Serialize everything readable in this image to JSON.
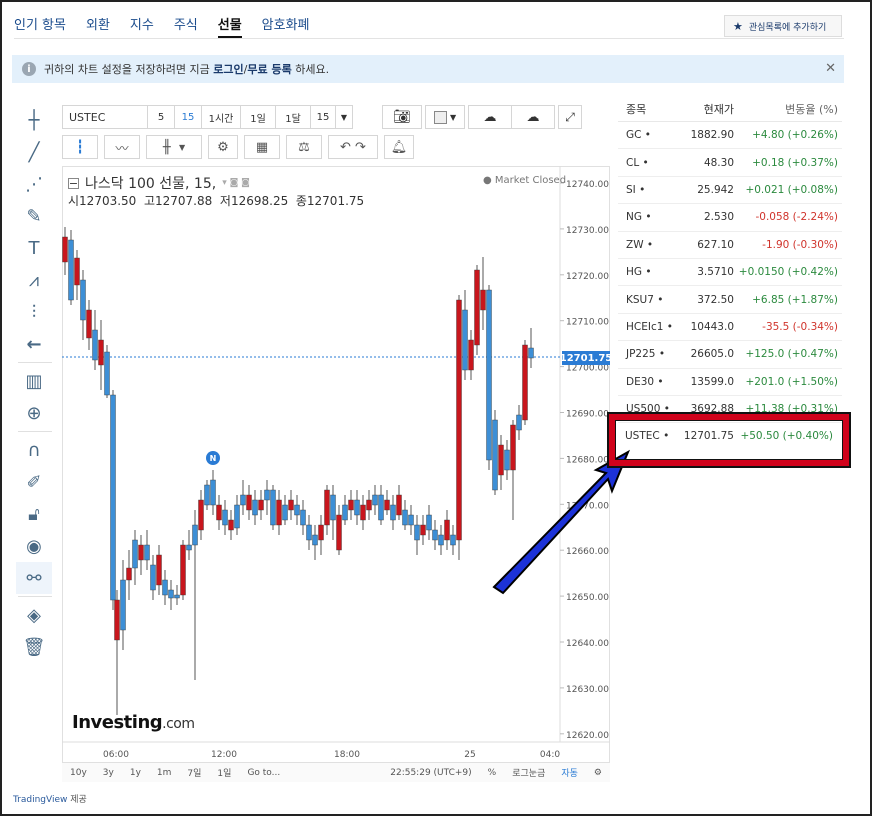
{
  "nav": {
    "tabs": [
      "인기 항목",
      "외환",
      "지수",
      "주식",
      "선물",
      "암호화폐"
    ],
    "active": 4,
    "watch_label": "관심목록에 추가하기"
  },
  "banner": {
    "prefix": "귀하의 차트 설정을 저장하려면 지금",
    "login": "로그인",
    "sep": " / ",
    "register": "무료 등록",
    "suffix": "하세요."
  },
  "toolbar": {
    "symbol": "USTEC",
    "intervals": [
      "5",
      "15",
      "1시간",
      "1일",
      "1달",
      "15"
    ],
    "active_interval": "15"
  },
  "chart": {
    "title": "나스닥 100 선물, 15,",
    "o_label": "시",
    "o": "12703.50",
    "h_label": "고",
    "h": "12707.88",
    "l_label": "저",
    "l": "12698.25",
    "c_label": "종",
    "c": "12701.75",
    "market_status": "Market Closed",
    "price_tag": "12701.75",
    "logo_main": "Investing",
    "logo_dot": ".com",
    "event_badge": "N",
    "y_ticks": [
      "12740.00",
      "12730.00",
      "12720.00",
      "12710.00",
      "12700.00",
      "12690.00",
      "12680.00",
      "12670.00",
      "12660.00",
      "12650.00",
      "12640.00",
      "12630.00",
      "12620.00"
    ],
    "x_ticks": [
      "06:00",
      "12:00",
      "18:00",
      "25",
      "04:0"
    ]
  },
  "bottombar": {
    "ranges": [
      "10y",
      "3y",
      "1y",
      "1m",
      "7일",
      "1일",
      "Go to..."
    ],
    "time": "22:55:29 (UTC+9)",
    "pct": "%",
    "log": "로그눈금",
    "auto": "자동"
  },
  "credit": {
    "brand": "TradingView",
    "suffix": " 제공"
  },
  "watchlist": {
    "headers": [
      "종목",
      "현재가",
      "변동율 (%)"
    ],
    "rows": [
      {
        "sym": "GC",
        "price": "1882.90",
        "chg": "+4.80 (+0.26%)",
        "dir": "up"
      },
      {
        "sym": "CL",
        "price": "48.30",
        "chg": "+0.18 (+0.37%)",
        "dir": "up"
      },
      {
        "sym": "SI",
        "price": "25.942",
        "chg": "+0.021 (+0.08%)",
        "dir": "up"
      },
      {
        "sym": "NG",
        "price": "2.530",
        "chg": "-0.058 (-2.24%)",
        "dir": "dn"
      },
      {
        "sym": "ZW",
        "price": "627.10",
        "chg": "-1.90 (-0.30%)",
        "dir": "dn"
      },
      {
        "sym": "HG",
        "price": "3.5710",
        "chg": "+0.0150 (+0.42%)",
        "dir": "up"
      },
      {
        "sym": "KSU7",
        "price": "372.50",
        "chg": "+6.85 (+1.87%)",
        "dir": "up"
      },
      {
        "sym": "HCEIc1",
        "price": "10443.0",
        "chg": "-35.5 (-0.34%)",
        "dir": "dn"
      },
      {
        "sym": "JP225",
        "price": "26605.0",
        "chg": "+125.0 (+0.47%)",
        "dir": "up"
      },
      {
        "sym": "DE30",
        "price": "13599.0",
        "chg": "+201.0 (+1.50%)",
        "dir": "up"
      },
      {
        "sym": "US500",
        "price": "3692.88",
        "chg": "+11.38 (+0.31%)",
        "dir": "up"
      }
    ],
    "highlight": {
      "sym": "USTEC",
      "price": "12701.75",
      "chg": "+50.50 (+0.40%)"
    }
  },
  "colors": {
    "up": "#2b8a3e",
    "down": "#d0342c",
    "candle_up": "#3d8fd6",
    "candle_down": "#c8161d",
    "annotation": "#d0021b"
  }
}
